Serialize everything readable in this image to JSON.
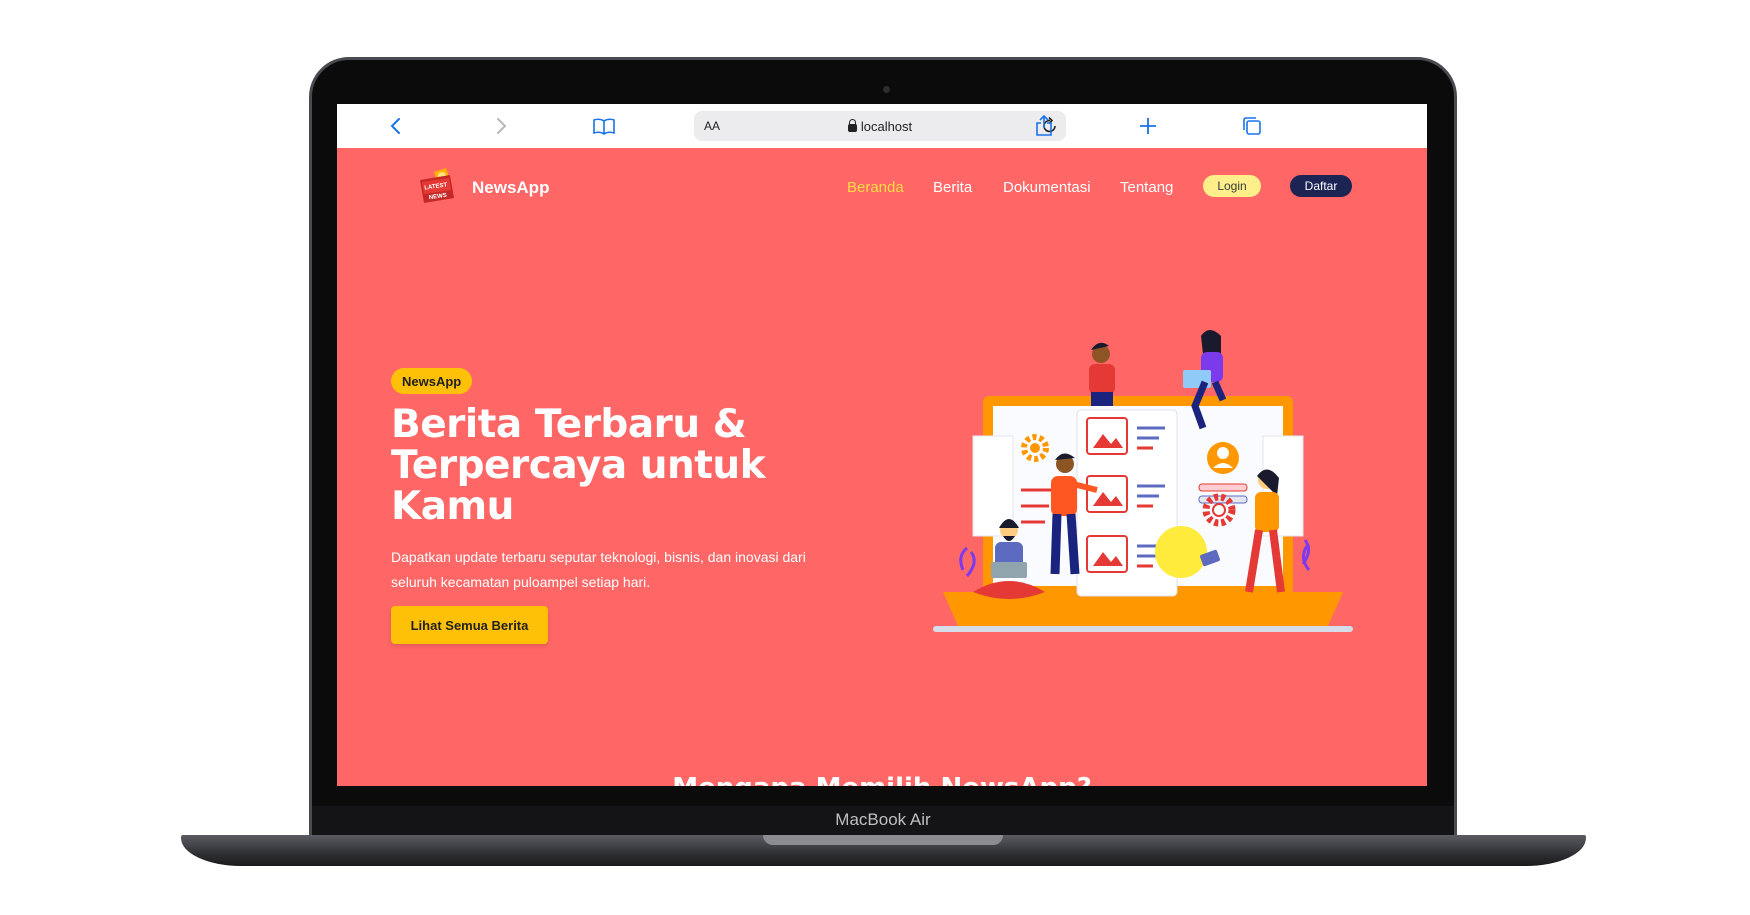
{
  "browser": {
    "url": "localhost",
    "text_size_label": "AA"
  },
  "device": {
    "brand_label": "MacBook Air"
  },
  "nav": {
    "logo_text": "NewsApp",
    "logo_badge_lines": [
      "LATEST",
      "NEWS"
    ],
    "items": [
      {
        "label": "Beranda",
        "active": true
      },
      {
        "label": "Berita",
        "active": false
      },
      {
        "label": "Dokumentasi",
        "active": false
      },
      {
        "label": "Tentang",
        "active": false
      }
    ],
    "login_label": "Login",
    "register_label": "Daftar"
  },
  "hero": {
    "badge": "NewsApp",
    "title_lines": [
      "Berita Terbaru &",
      "Terpercaya untuk",
      "Kamu"
    ],
    "description_lines": [
      "Dapatkan update terbaru seputar teknologi, bisnis, dan inovasi dari",
      "seluruh kecamatan puloampel setiap hari."
    ],
    "cta_label": "Lihat Semua Berita"
  },
  "next_section": {
    "heading": "Mengapa Memilih NewsApp?"
  },
  "colors": {
    "page_bg": "#ff6666",
    "accent_yellow": "#ffc107",
    "active_nav": "#ffdd44",
    "register_bg": "#1c2453",
    "login_bg": "#ffef8a"
  }
}
